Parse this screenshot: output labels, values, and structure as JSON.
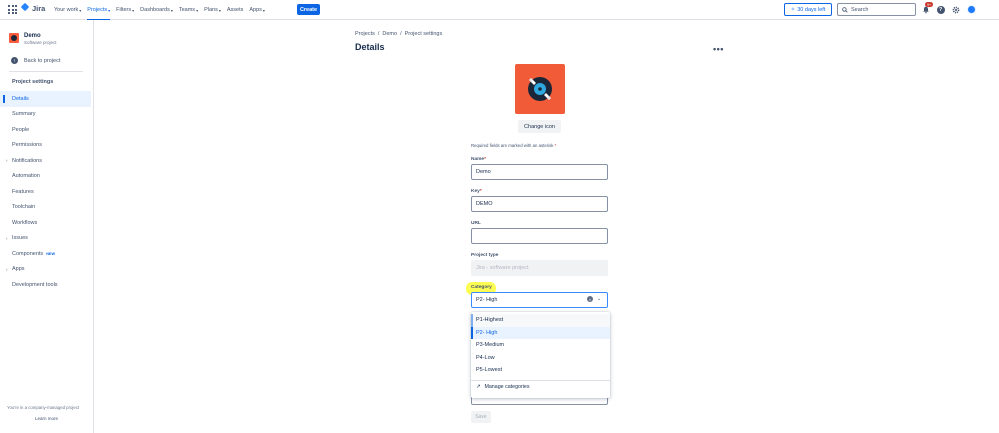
{
  "app": {
    "name": "Jira"
  },
  "nav": {
    "items": [
      {
        "label": "Your work",
        "active": false
      },
      {
        "label": "Projects",
        "active": true
      },
      {
        "label": "Filters",
        "active": false
      },
      {
        "label": "Dashboards",
        "active": false
      },
      {
        "label": "Teams",
        "active": false
      },
      {
        "label": "Plans",
        "active": false
      },
      {
        "label": "Assets",
        "active": false
      },
      {
        "label": "Apps",
        "active": false
      }
    ],
    "create_label": "Create",
    "trial_label": "30 days left",
    "search_placeholder": "Search",
    "notification_count": "9+"
  },
  "sidebar": {
    "project_name": "Demo",
    "project_type": "Software project",
    "back_label": "Back to project",
    "section_title": "Project settings",
    "items": [
      {
        "label": "Details",
        "active": true,
        "expandable": false,
        "badge": ""
      },
      {
        "label": "Summary",
        "active": false,
        "expandable": false,
        "badge": ""
      },
      {
        "label": "People",
        "active": false,
        "expandable": false,
        "badge": ""
      },
      {
        "label": "Permissions",
        "active": false,
        "expandable": false,
        "badge": ""
      },
      {
        "label": "Notifications",
        "active": false,
        "expandable": true,
        "badge": ""
      },
      {
        "label": "Automation",
        "active": false,
        "expandable": false,
        "badge": ""
      },
      {
        "label": "Features",
        "active": false,
        "expandable": false,
        "badge": ""
      },
      {
        "label": "Toolchain",
        "active": false,
        "expandable": false,
        "badge": ""
      },
      {
        "label": "Workflows",
        "active": false,
        "expandable": false,
        "badge": ""
      },
      {
        "label": "Issues",
        "active": false,
        "expandable": true,
        "badge": ""
      },
      {
        "label": "Components",
        "active": false,
        "expandable": false,
        "badge": "NEW"
      },
      {
        "label": "Apps",
        "active": false,
        "expandable": true,
        "badge": ""
      },
      {
        "label": "Development tools",
        "active": false,
        "expandable": false,
        "badge": ""
      }
    ],
    "footer_note": "You're in a company-managed project",
    "learn_more": "Learn more"
  },
  "main": {
    "breadcrumb": [
      "Projects",
      "Demo",
      "Project settings"
    ],
    "breadcrumb_sep": "/",
    "title": "Details",
    "change_icon_label": "Change icon",
    "required_note": "Required fields are marked with an asterisk",
    "fields": {
      "name": {
        "label": "Name",
        "value": "Demo"
      },
      "key": {
        "label": "Key",
        "value": "DEMO"
      },
      "url": {
        "label": "URL",
        "value": ""
      },
      "project_type": {
        "label": "Project type",
        "value": "Jira - software project"
      },
      "category": {
        "label": "Category",
        "value": "P2- High"
      }
    },
    "category_options": [
      "P1-Highest",
      "P2- High",
      "P3-Medium",
      "P4-Low",
      "P5-Lowest"
    ],
    "selected_option_index": 1,
    "manage_categories": "Manage categories",
    "save_label": "Save"
  },
  "colors": {
    "brand": "#0c66e4",
    "project_icon_bg": "#f15b37",
    "highlight": "#fbfd53"
  }
}
